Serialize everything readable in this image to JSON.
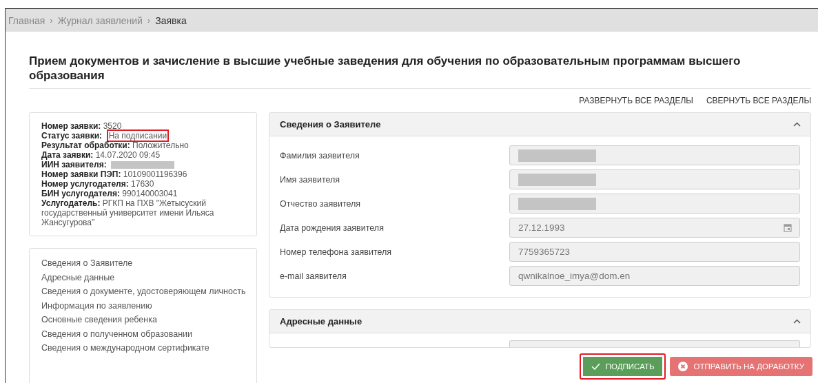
{
  "breadcrumbs": [
    {
      "kind": "link",
      "label": "Главная",
      "current": false
    },
    {
      "kind": "separator",
      "label": "›"
    },
    {
      "kind": "link",
      "label": "Журнал заявлений",
      "current": false
    },
    {
      "kind": "separator",
      "label": "›"
    },
    {
      "kind": "link",
      "label": "Заявка",
      "current": true
    }
  ],
  "title": "Прием документов и зачисление в высшие учебные заведения для обучения по образовательным программам высшего образования",
  "section_actions": [
    "РАЗВЕРНУТЬ ВСЕ РАЗДЕЛЫ",
    "СВЕРНУТЬ ВСЕ РАЗДЕЛЫ"
  ],
  "summary": [
    {
      "kind": "line",
      "text": "**Номер заявки:** 3520"
    },
    {
      "kind": "highlighted",
      "label": "Статус заявки:",
      "value": "На подписании"
    },
    {
      "kind": "line",
      "text": "**Результат обработки:** Положительно"
    },
    {
      "kind": "line",
      "text": "**Дата заявки:** 14.07.2020 09:45"
    },
    {
      "kind": "redacted",
      "label": "ИИН заявителя:"
    },
    {
      "kind": "line",
      "text": "**Номер заявки ПЭП:** 10109001196396"
    },
    {
      "kind": "line",
      "text": "**Номер услугодателя:** 17630"
    },
    {
      "kind": "line",
      "text": "**БИН услугодателя:** 990140003041"
    },
    {
      "kind": "line",
      "text": "**Услугодатель:** РГКП на ПХВ \"Жетысуский государственный университет имени Ильяса Жансугурова\""
    }
  ],
  "navigation": [
    "Сведения о Заявителе",
    "Адресные данные",
    "Сведения о документе, удостоверяющем личность",
    "Информация по заявлению",
    "Основные сведения ребенка",
    "Сведения о полученном образовании",
    "Сведения о международном сертификате"
  ],
  "sections": [
    {
      "title": "Сведения о Заявителе",
      "expanded": true,
      "fields": [
        {
          "label": "Фамилия заявителя",
          "kind": "redacted"
        },
        {
          "label": "Имя заявителя",
          "kind": "redacted"
        },
        {
          "label": "Отчество заявителя",
          "kind": "redacted"
        },
        {
          "label": "Дата рождения заявителя",
          "kind": "date",
          "value": "27.12.1993"
        },
        {
          "label": "Номер телефона заявителя",
          "kind": "text",
          "value": "7759365723"
        },
        {
          "label": "e-mail заявителя",
          "kind": "text",
          "value": "qwnikalnoe_imya@dom.en"
        }
      ]
    },
    {
      "title": "Адресные данные",
      "expanded": true,
      "fields": [
        {
          "kind": "redacted"
        }
      ]
    }
  ],
  "actions": [
    {
      "label": "ПОДПИСАТЬ",
      "kind": "sign",
      "highlighted": true
    },
    {
      "label": "ОТПРАВИТЬ НА ДОРАБОТКУ",
      "kind": "reject",
      "highlighted": false
    }
  ]
}
